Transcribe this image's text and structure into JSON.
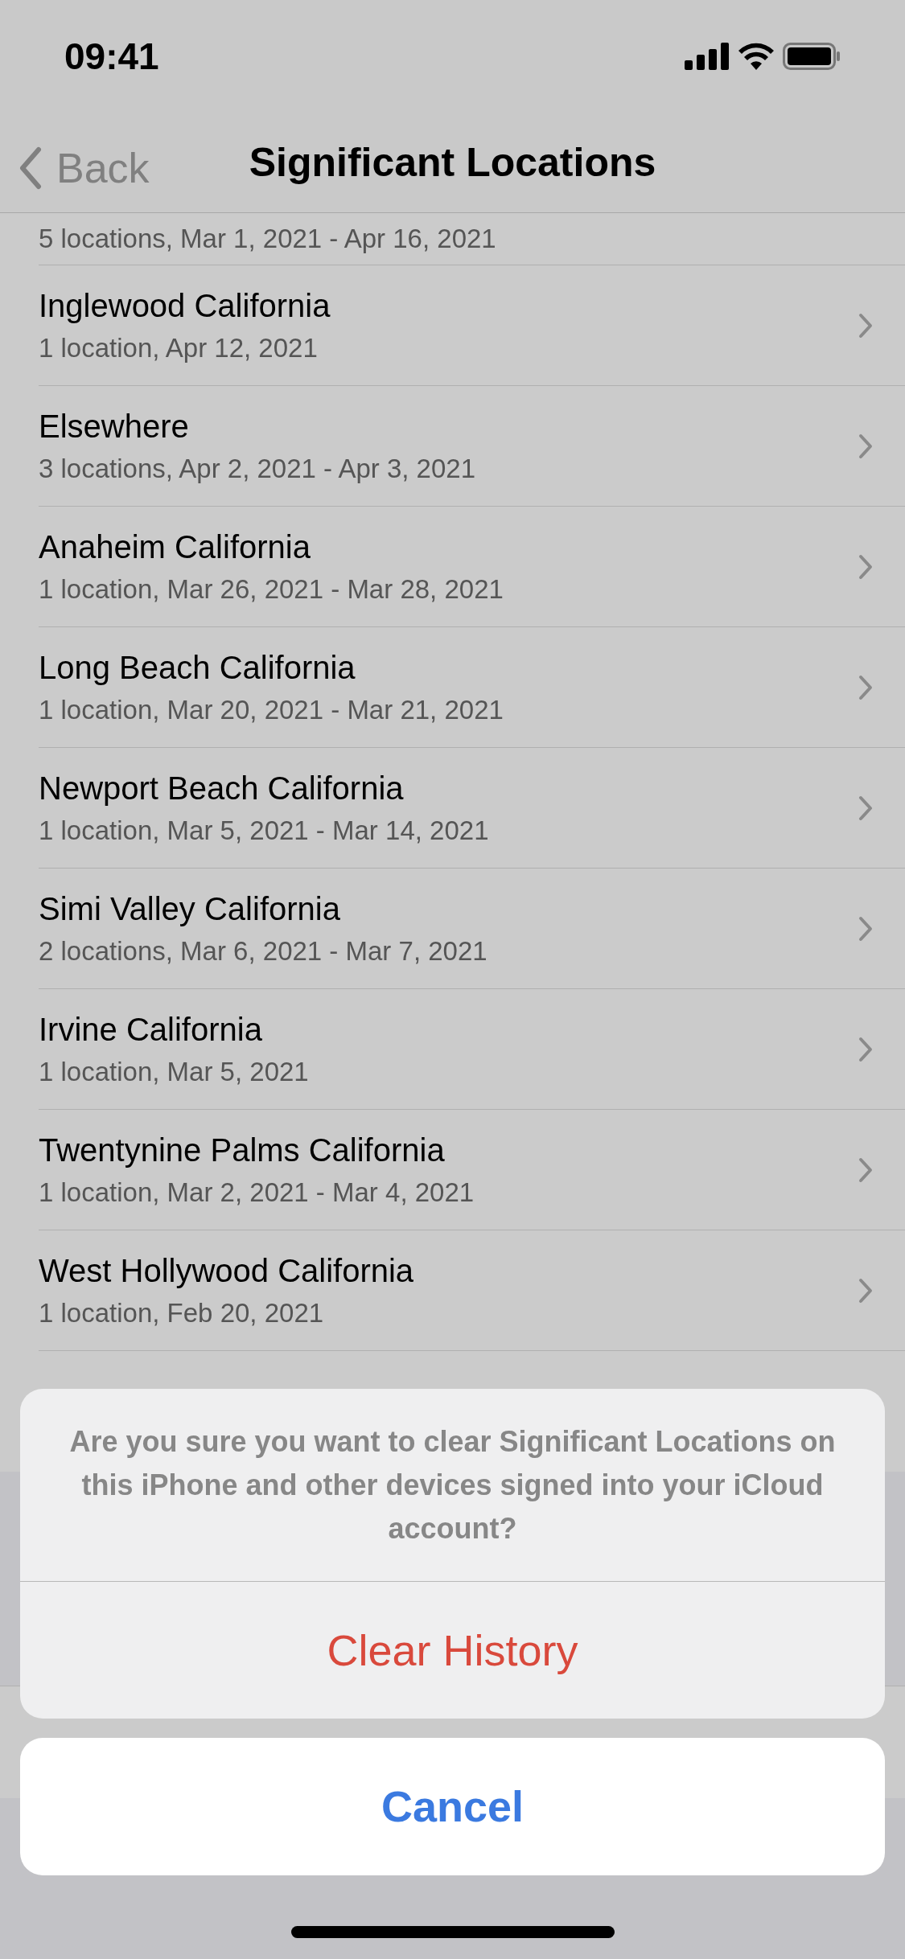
{
  "status_bar": {
    "time": "09:41"
  },
  "nav": {
    "back": "Back",
    "title": "Significant Locations"
  },
  "locations": [
    {
      "detail": "5 locations, Mar 1, 2021 - Apr 16, 2021"
    },
    {
      "name": "Inglewood California",
      "detail": "1 location, Apr 12, 2021"
    },
    {
      "name": "Elsewhere",
      "detail": "3 locations, Apr 2, 2021 - Apr 3, 2021"
    },
    {
      "name": "Anaheim California",
      "detail": "1 location, Mar 26, 2021 - Mar 28, 2021"
    },
    {
      "name": "Long Beach California",
      "detail": "1 location, Mar 20, 2021 - Mar 21, 2021"
    },
    {
      "name": "Newport Beach California",
      "detail": "1 location, Mar 5, 2021 - Mar 14, 2021"
    },
    {
      "name": "Simi Valley California",
      "detail": "2 locations, Mar 6, 2021 - Mar 7, 2021"
    },
    {
      "name": "Irvine California",
      "detail": "1 location, Mar 5, 2021"
    },
    {
      "name": "Twentynine Palms California",
      "detail": "1 location, Mar 2, 2021 - Mar 4, 2021"
    },
    {
      "name": "West Hollywood California",
      "detail": "1 location, Feb 20, 2021"
    }
  ],
  "action_sheet": {
    "message": "Are you sure you want to clear Significant Locations on this iPhone and other devices signed into your iCloud account?",
    "actions": [
      {
        "label": "Clear History",
        "kind": "destructive"
      }
    ],
    "cancel": "Cancel"
  }
}
